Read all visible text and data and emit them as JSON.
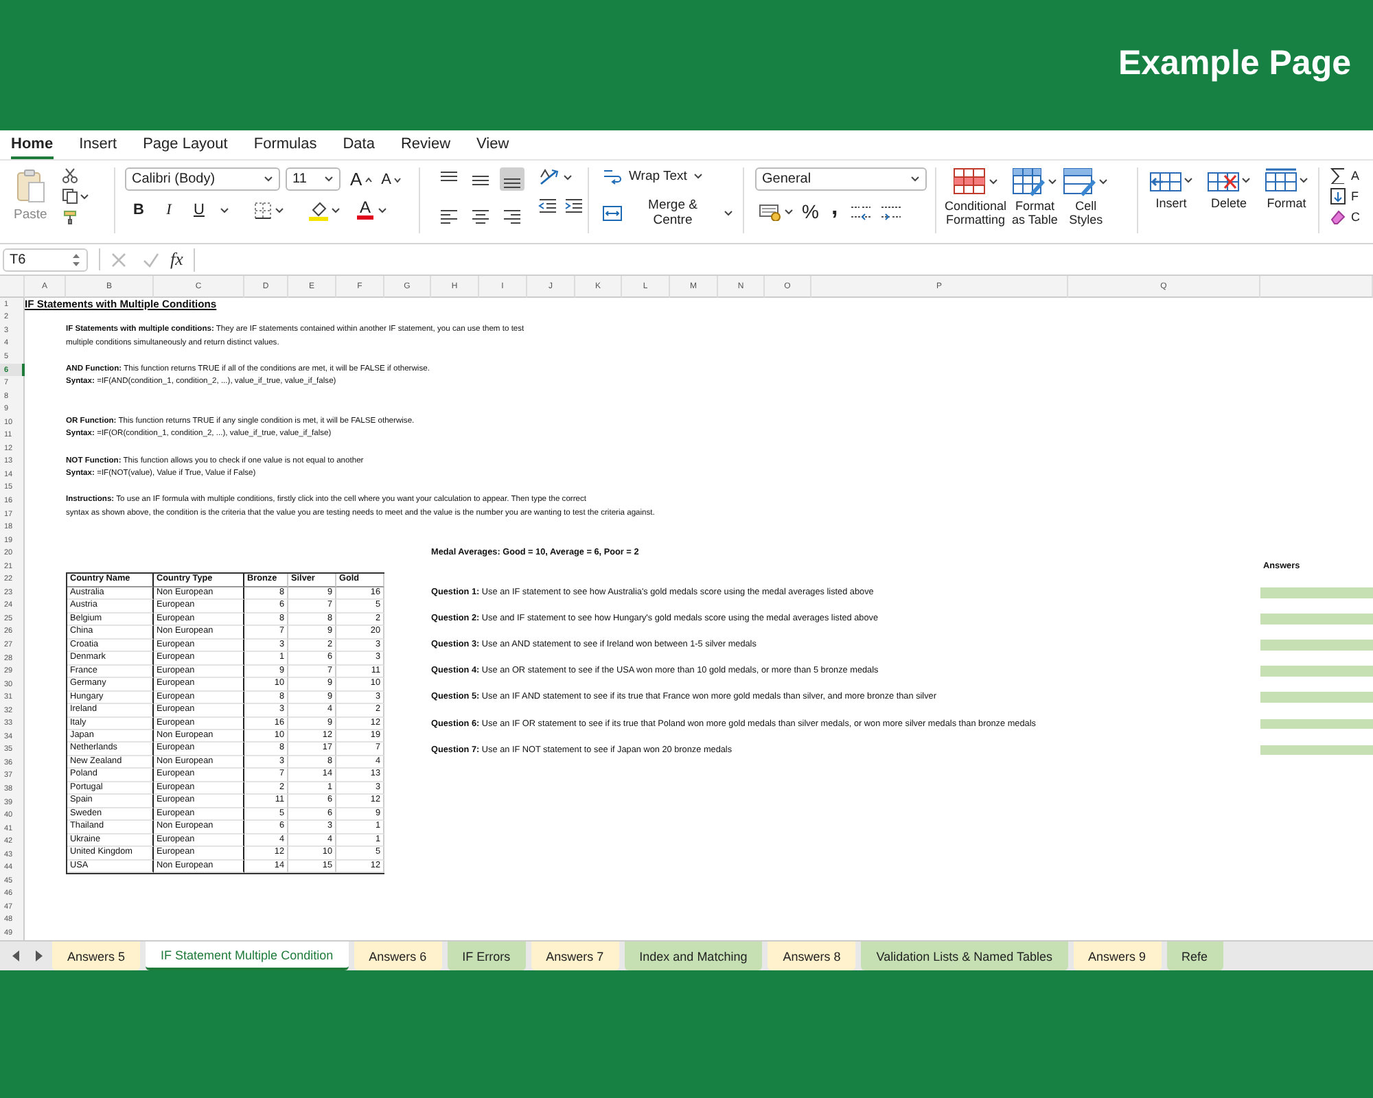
{
  "banner": {
    "title": "Example Page"
  },
  "ribbon_tabs": [
    {
      "label": "Home",
      "selected": true
    },
    {
      "label": "Insert",
      "selected": false
    },
    {
      "label": "Page Layout",
      "selected": false
    },
    {
      "label": "Formulas",
      "selected": false
    },
    {
      "label": "Data",
      "selected": false
    },
    {
      "label": "Review",
      "selected": false
    },
    {
      "label": "View",
      "selected": false
    }
  ],
  "ribbon": {
    "paste_label": "Paste",
    "font_name": "Calibri (Body)",
    "font_size": "11",
    "grow_font": "A",
    "shrink_font": "A",
    "format_buttons": [
      "B",
      "I",
      "U"
    ],
    "font_color": "A",
    "align_buttons": [
      {
        "kind": "top",
        "selected": false
      },
      {
        "kind": "middle",
        "selected": false
      },
      {
        "kind": "bottom",
        "selected": true
      },
      {
        "kind": "left",
        "selected": false
      },
      {
        "kind": "center",
        "selected": false
      },
      {
        "kind": "right",
        "selected": false
      }
    ],
    "wrap_text": "Wrap Text",
    "merge": "Merge & Centre",
    "number_format": "General",
    "percent": "%",
    "comma": ",",
    "style_buttons": [
      "Conditional\nFormatting",
      "Format\nas Table",
      "Cell\nStyles"
    ],
    "cell_buttons": [
      "Insert",
      "Delete",
      "Format"
    ],
    "edge_letters": [
      "A",
      "F",
      "C"
    ]
  },
  "formula_bar": {
    "name_box": "T6",
    "fx": "fx"
  },
  "columns": [
    "A",
    "B",
    "C",
    "D",
    "E",
    "F",
    "G",
    "H",
    "I",
    "J",
    "K",
    "L",
    "M",
    "N",
    "O",
    "P",
    "Q"
  ],
  "rows": [
    {
      "number": "1",
      "selected": false
    },
    {
      "number": "2",
      "selected": false
    },
    {
      "number": "3",
      "selected": false
    },
    {
      "number": "4",
      "selected": false
    },
    {
      "number": "5",
      "selected": false
    },
    {
      "number": "6",
      "selected": true
    },
    {
      "number": "7",
      "selected": false
    },
    {
      "number": "8",
      "selected": false
    },
    {
      "number": "9",
      "selected": false
    },
    {
      "number": "10",
      "selected": false
    },
    {
      "number": "11",
      "selected": false
    },
    {
      "number": "12",
      "selected": false
    },
    {
      "number": "13",
      "selected": false
    },
    {
      "number": "14",
      "selected": false
    },
    {
      "number": "15",
      "selected": false
    },
    {
      "number": "16",
      "selected": false
    },
    {
      "number": "17",
      "selected": false
    },
    {
      "number": "18",
      "selected": false
    },
    {
      "number": "19",
      "selected": false
    },
    {
      "number": "20",
      "selected": false
    },
    {
      "number": "21",
      "selected": false
    },
    {
      "number": "22",
      "selected": false
    },
    {
      "number": "23",
      "selected": false
    },
    {
      "number": "24",
      "selected": false
    },
    {
      "number": "25",
      "selected": false
    },
    {
      "number": "26",
      "selected": false
    },
    {
      "number": "27",
      "selected": false
    },
    {
      "number": "28",
      "selected": false
    },
    {
      "number": "29",
      "selected": false
    },
    {
      "number": "30",
      "selected": false
    },
    {
      "number": "31",
      "selected": false
    },
    {
      "number": "32",
      "selected": false
    },
    {
      "number": "33",
      "selected": false
    },
    {
      "number": "34",
      "selected": false
    },
    {
      "number": "35",
      "selected": false
    },
    {
      "number": "36",
      "selected": false
    },
    {
      "number": "37",
      "selected": false
    },
    {
      "number": "38",
      "selected": false
    },
    {
      "number": "39",
      "selected": false
    },
    {
      "number": "40",
      "selected": false
    },
    {
      "number": "41",
      "selected": false
    },
    {
      "number": "42",
      "selected": false
    },
    {
      "number": "43",
      "selected": false
    },
    {
      "number": "44",
      "selected": false
    },
    {
      "number": "45",
      "selected": false
    },
    {
      "number": "46",
      "selected": false
    },
    {
      "number": "47",
      "selected": false
    },
    {
      "number": "48",
      "selected": false
    },
    {
      "number": "49",
      "selected": false
    }
  ],
  "sheet": {
    "title": "IF Statements with Multiple Conditions",
    "notes": [
      "**IF Statements with multiple conditions:** They are IF statements contained within another IF statement, you can use them to test",
      "multiple conditions simultaneously and return distinct values.",
      "**AND Function:** This function returns TRUE if all of the conditions are met, it will be FALSE if otherwise.",
      "**Syntax:** =IF(AND(condition_1, condition_2, ...), value_if_true, value_if_false)",
      "**OR Function:** This function returns TRUE if any single condition is met, it will be FALSE otherwise.",
      "**Syntax:** =IF(OR(condition_1, condition_2, ...), value_if_true, value_if_false)",
      "**NOT Function:** This function allows you to check if one value is not equal to another",
      "**Syntax:** =IF(NOT(value), Value if True, Value if False)",
      "**Instructions:** To use an IF formula with multiple conditions, firstly click into the cell where you want your calculation to appear. Then type the correct",
      "syntax as shown above, the condition is the criteria that the value you are testing needs to meet and the value is the number you are wanting to test the criteria against."
    ],
    "medal_averages": "Medal Averages: Good = 10, Average = 6, Poor = 2",
    "answers_label": "Answers",
    "questions": [
      "**Question 1:** Use an IF statement to see how Australia's gold medals score using the medal averages listed above",
      "**Question 2:** Use and IF statement to see how Hungary's gold medals score using the medal averages listed above",
      "**Question 3:** Use an AND statement to see if Ireland won between 1-5 silver medals",
      "**Question 4:** Use an OR statement to see if the USA won more than 10 gold medals, or more than 5 bronze medals",
      "**Question 5:** Use an IF AND statement to see if its true that France won more gold medals than silver, and more bronze than silver",
      "**Question 6:** Use an IF OR statement to see if its true that Poland won more gold medals than silver medals, or won more silver medals than bronze medals",
      "**Question 7:** Use an IF NOT statement to see if Japan won 20 bronze medals"
    ],
    "table": {
      "columns": [
        "Country Name",
        "Country Type",
        "Bronze",
        "Silver",
        "Gold"
      ],
      "rows": [
        [
          "Australia",
          "Non European",
          "8",
          "9",
          "16"
        ],
        [
          "Austria",
          "European",
          "6",
          "7",
          "5"
        ],
        [
          "Belgium",
          "European",
          "8",
          "8",
          "2"
        ],
        [
          "China",
          "Non European",
          "7",
          "9",
          "20"
        ],
        [
          "Croatia",
          "European",
          "3",
          "2",
          "3"
        ],
        [
          "Denmark",
          "European",
          "1",
          "6",
          "3"
        ],
        [
          "France",
          "European",
          "9",
          "7",
          "11"
        ],
        [
          "Germany",
          "European",
          "10",
          "9",
          "10"
        ],
        [
          "Hungary",
          "European",
          "8",
          "9",
          "3"
        ],
        [
          "Ireland",
          "European",
          "3",
          "4",
          "2"
        ],
        [
          "Italy",
          "European",
          "16",
          "9",
          "12"
        ],
        [
          "Japan",
          "Non European",
          "10",
          "12",
          "19"
        ],
        [
          "Netherlands",
          "European",
          "8",
          "17",
          "7"
        ],
        [
          "New Zealand",
          "Non European",
          "3",
          "8",
          "4"
        ],
        [
          "Poland",
          "European",
          "7",
          "14",
          "13"
        ],
        [
          "Portugal",
          "European",
          "2",
          "1",
          "3"
        ],
        [
          "Spain",
          "European",
          "11",
          "6",
          "12"
        ],
        [
          "Sweden",
          "European",
          "5",
          "6",
          "9"
        ],
        [
          "Thailand",
          "Non European",
          "6",
          "3",
          "1"
        ],
        [
          "Ukraine",
          "European",
          "4",
          "4",
          "1"
        ],
        [
          "United Kingdom",
          "European",
          "12",
          "10",
          "5"
        ],
        [
          "USA",
          "Non European",
          "14",
          "15",
          "12"
        ]
      ]
    }
  },
  "sheet_tabs": [
    {
      "label": "Answers 5",
      "selected": false,
      "color": "#fff2cc"
    },
    {
      "label": "IF Statement Multiple Condition",
      "selected": true
    },
    {
      "label": "Answers 6",
      "selected": false,
      "color": "#fff2cc"
    },
    {
      "label": "IF Errors",
      "selected": false,
      "color": "#c6e0b4"
    },
    {
      "label": "Answers 7",
      "selected": false,
      "color": "#fff2cc"
    },
    {
      "label": "Index and Matching",
      "selected": false,
      "color": "#c6e0b4"
    },
    {
      "label": "Answers 8",
      "selected": false,
      "color": "#fff2cc"
    },
    {
      "label": "Validation Lists & Named Tables",
      "selected": false,
      "color": "#c6e0b4"
    },
    {
      "label": "Answers 9",
      "selected": false,
      "color": "#fff2cc"
    },
    {
      "label": "Refe",
      "selected": false,
      "color": "#c6e0b4"
    }
  ]
}
